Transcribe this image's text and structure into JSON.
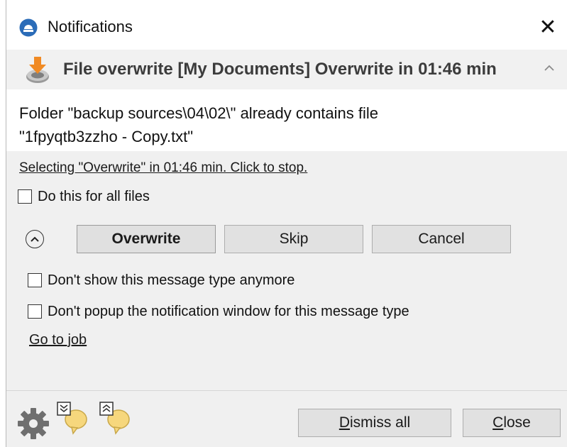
{
  "window": {
    "title": "Notifications",
    "close_glyph": "✕"
  },
  "notification": {
    "title": "File overwrite [My Documents] Overwrite in 01:46 min",
    "collapse_glyph": "^",
    "message_line1": "Folder \"backup sources\\04\\02\\\" already contains file",
    "message_line2": "\"1fpyqtb3zzho - Copy.txt\"",
    "auto_select_text": "Selecting \"Overwrite\" in 01:46 min. Click to stop.",
    "do_all_label": "Do this for all files",
    "buttons": {
      "overwrite": "Overwrite",
      "skip": "Skip",
      "cancel": "Cancel"
    },
    "dont_show_label": "Don't show this message type anymore",
    "dont_popup_label": "Don't popup the notification window for this message type",
    "goto_job": "Go to job"
  },
  "footer": {
    "dismiss_all_mnemonic": "D",
    "dismiss_all_rest": "ismiss all",
    "close_mnemonic": "C",
    "close_rest": "lose"
  },
  "icons": {
    "app": "notification-app-icon",
    "download": "download-arrow-icon",
    "settings": "gear-icon",
    "expand_all": "expand-all-bubble-icon",
    "collapse_all": "collapse-all-bubble-icon"
  },
  "colors": {
    "accent_blue": "#2b6cb8",
    "download_orange": "#f08a24",
    "bubble_yellow": "#f6d77d",
    "header_band": "#f1f1f1",
    "panel_gray": "#f0f0f0"
  }
}
